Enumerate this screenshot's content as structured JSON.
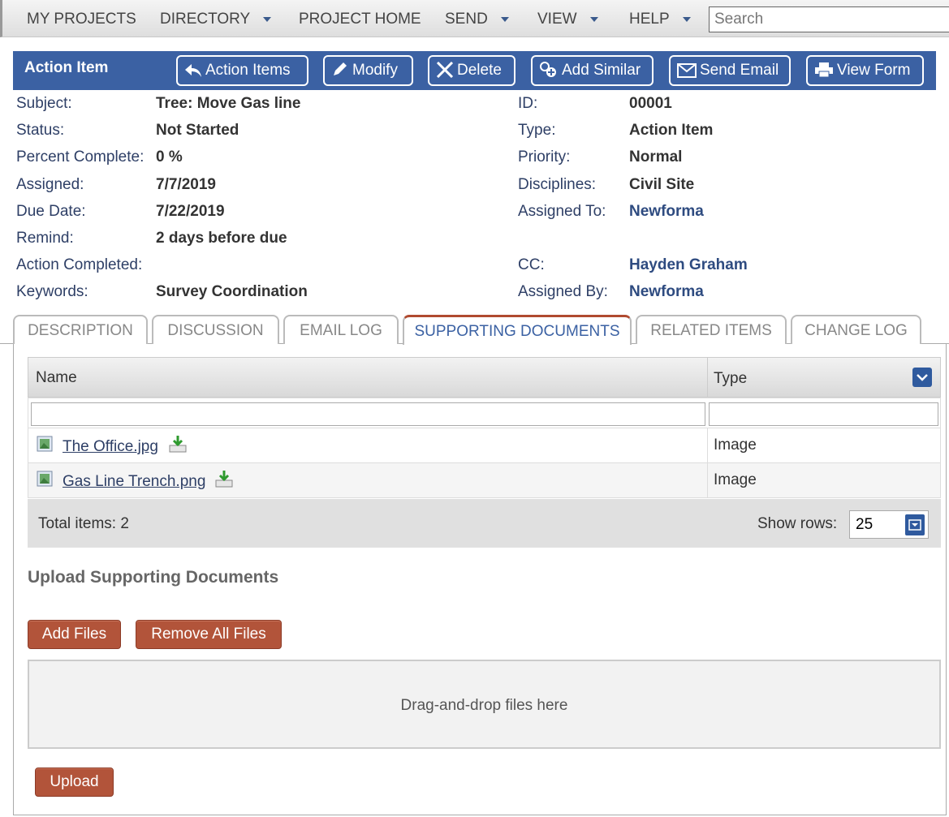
{
  "nav": {
    "items": [
      "MY PROJECTS",
      "DIRECTORY",
      "PROJECT HOME",
      "SEND",
      "VIEW",
      "HELP"
    ],
    "search_placeholder": "Search"
  },
  "header": {
    "title": "Action Item",
    "buttons": [
      "Action Items",
      "Modify",
      "Delete",
      "Add Similar",
      "Send Email",
      "View Form"
    ]
  },
  "fields_left": [
    {
      "label": "Subject:",
      "value": "Tree: Move Gas line"
    },
    {
      "label": "Status:",
      "value": "Not Started"
    },
    {
      "label": "Percent Complete:",
      "value": "0 %"
    },
    {
      "label": "Assigned:",
      "value": "7/7/2019"
    },
    {
      "label": "Due Date:",
      "value": "7/22/2019"
    },
    {
      "label": "Remind:",
      "value": "2 days before due"
    },
    {
      "label": "Action Completed:",
      "value": ""
    },
    {
      "label": "Keywords:",
      "value": "Survey Coordination"
    }
  ],
  "fields_right": [
    {
      "label": "ID:",
      "value": "00001"
    },
    {
      "label": "Type:",
      "value": "Action Item"
    },
    {
      "label": "Priority:",
      "value": "Normal"
    },
    {
      "label": "Disciplines:",
      "value": "Civil Site"
    },
    {
      "label": "Assigned To:",
      "value": "Newforma"
    },
    {
      "label": "",
      "value": ""
    },
    {
      "label": "CC:",
      "value": "Hayden Graham"
    },
    {
      "label": "Assigned By:",
      "value": "Newforma"
    }
  ],
  "tabs": [
    "DESCRIPTION",
    "DISCUSSION",
    "EMAIL LOG",
    "SUPPORTING DOCUMENTS",
    "RELATED ITEMS",
    "CHANGE LOG"
  ],
  "active_tab": "SUPPORTING DOCUMENTS",
  "grid": {
    "columns": [
      "Name",
      "Type"
    ],
    "rows": [
      {
        "name": "The Office.jpg",
        "type": "Image"
      },
      {
        "name": "Gas Line Trench.png",
        "type": "Image"
      }
    ],
    "total": "Total items: 2",
    "show_rows_label": "Show rows:",
    "show_rows_value": "25"
  },
  "upload": {
    "title": "Upload Supporting Documents",
    "add_files": "Add Files",
    "remove_all": "Remove All Files",
    "drop_text": "Drag-and-drop files here",
    "upload_button": "Upload"
  },
  "colors": {
    "header_blue": "#3b61a3",
    "link_blue": "#2e4b80",
    "button_brown": "#b2543a"
  }
}
